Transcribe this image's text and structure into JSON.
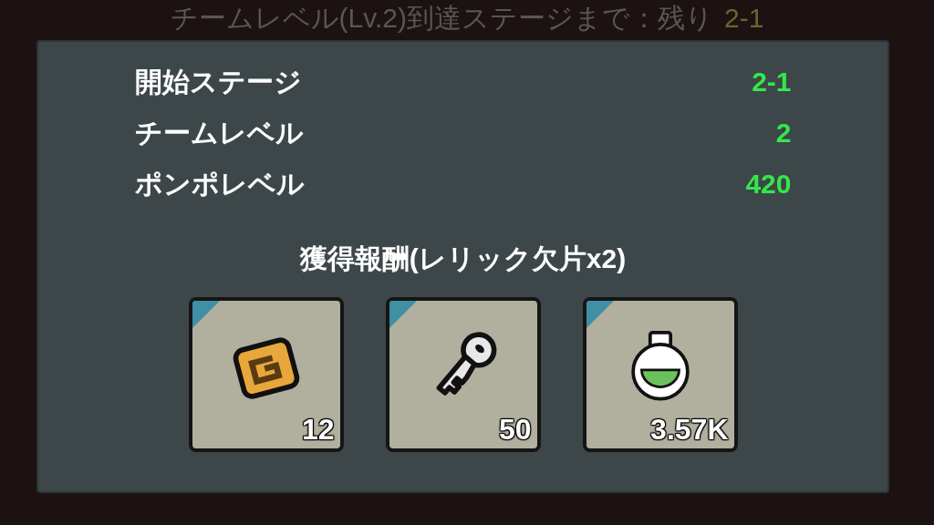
{
  "header": {
    "text": "チームレベル(Lv.2)到達ステージまで：残り",
    "highlight": "2-1"
  },
  "stats": [
    {
      "label": "開始ステージ",
      "value": "2-1"
    },
    {
      "label": "チームレベル",
      "value": "2"
    },
    {
      "label": "ポンポレベル",
      "value": "420"
    }
  ],
  "rewards": {
    "title": "獲得報酬(レリック欠片x2)",
    "items": [
      {
        "kind": "tile",
        "count": "12"
      },
      {
        "kind": "key",
        "count": "50"
      },
      {
        "kind": "potion",
        "count": "3.57K"
      }
    ]
  }
}
